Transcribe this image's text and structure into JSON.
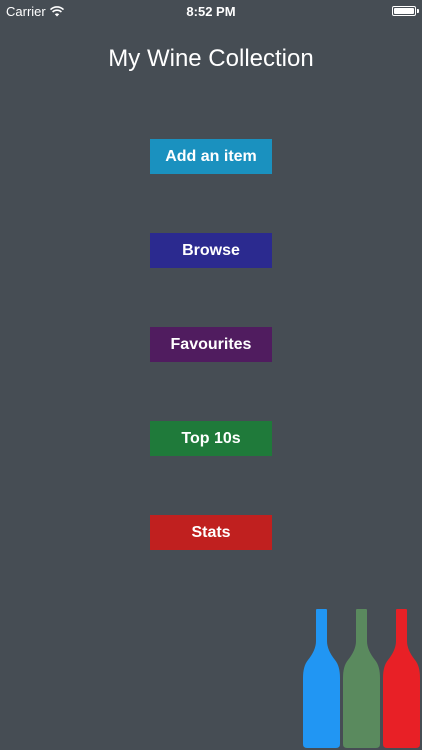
{
  "status_bar": {
    "carrier": "Carrier",
    "time": "8:52 PM",
    "wifi_icon": "wifi-icon",
    "battery_icon": "battery-icon"
  },
  "title": "My Wine Collection",
  "buttons": [
    {
      "label": "Add an item",
      "color": "#1a91bf"
    },
    {
      "label": "Browse",
      "color": "#2b2a8f"
    },
    {
      "label": "Favourites",
      "color": "#501c5f"
    },
    {
      "label": "Top 10s",
      "color": "#1f7a3a"
    },
    {
      "label": "Stats",
      "color": "#c0201f"
    }
  ],
  "decoration": {
    "icon": "wine-bottles-icon",
    "colors": [
      "#2196f3",
      "#5a8a5e",
      "#e82026"
    ]
  },
  "colors": {
    "background": "#464d54",
    "text": "#ffffff"
  }
}
